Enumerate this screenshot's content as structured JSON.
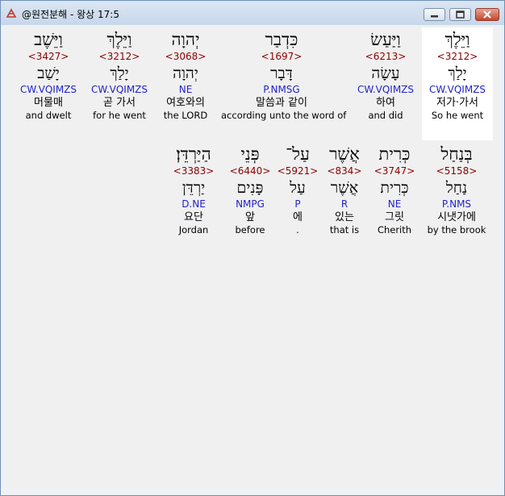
{
  "window": {
    "title": "@원전분해 - 왕상 17:5",
    "buttons": {
      "minimize": "minimize",
      "maximize": "maximize",
      "close": "close"
    }
  },
  "words": [
    {
      "heb": "וַיֵּלֶךְ",
      "num": "<3212>",
      "lemma": "יָלַךְ",
      "code": "CW.VQIMZS",
      "kor": "저가·가서",
      "eng": "So he went"
    },
    {
      "heb": "וַיַּעַשׂ",
      "num": "<6213>",
      "lemma": "עָשָׂה",
      "code": "CW.VQIMZS",
      "kor": "하여",
      "eng": "and did"
    },
    {
      "heb": "כִּדְבַר",
      "num": "<1697>",
      "lemma": "דָּבָר",
      "code": "P.NMSG",
      "kor": "말씀과 같이",
      "eng": "according unto the word of"
    },
    {
      "heb": "יְהוָה",
      "num": "<3068>",
      "lemma": "יְהוָה",
      "code": "NE",
      "kor": "여호와의",
      "eng": "the LORD"
    },
    {
      "heb": "וַיֵּלֶךְ",
      "num": "<3212>",
      "lemma": "יָלַךְ",
      "code": "CW.VQIMZS",
      "kor": "곧 가서",
      "eng": "for he went"
    },
    {
      "heb": "וַיֵּשֶׁב",
      "num": "<3427>",
      "lemma": "יָשַׁב",
      "code": "CW.VQIMZS",
      "kor": "머물매",
      "eng": "and dwelt"
    },
    {
      "heb": "בְּנַחַל",
      "num": "<5158>",
      "lemma": "נַחַל",
      "code": "P.NMS",
      "kor": "시냇가에",
      "eng": "by the brook"
    },
    {
      "heb": "כְּרִית",
      "num": "<3747>",
      "lemma": "כְּרִית",
      "code": "NE",
      "kor": "그릿",
      "eng": "Cherith"
    },
    {
      "heb": "אֲשֶׁר",
      "num": "<834>",
      "lemma": "אֲשֶׁר",
      "code": "R",
      "kor": "있는",
      "eng": "that is"
    },
    {
      "heb": "עַל־",
      "num": "<5921>",
      "lemma": "עַל",
      "code": "P",
      "kor": "에",
      "eng": "."
    },
    {
      "heb": "פְּנֵי",
      "num": "<6440>",
      "lemma": "פָּנִים",
      "code": "NMPG",
      "kor": "앞",
      "eng": "before"
    },
    {
      "heb": "הַיַּרְדֵּן׃",
      "num": "<3383>",
      "lemma": "יַרְדֵּן",
      "code": "D.NE",
      "kor": "요단",
      "eng": "Jordan"
    }
  ],
  "highlight_color": "#ffffff"
}
